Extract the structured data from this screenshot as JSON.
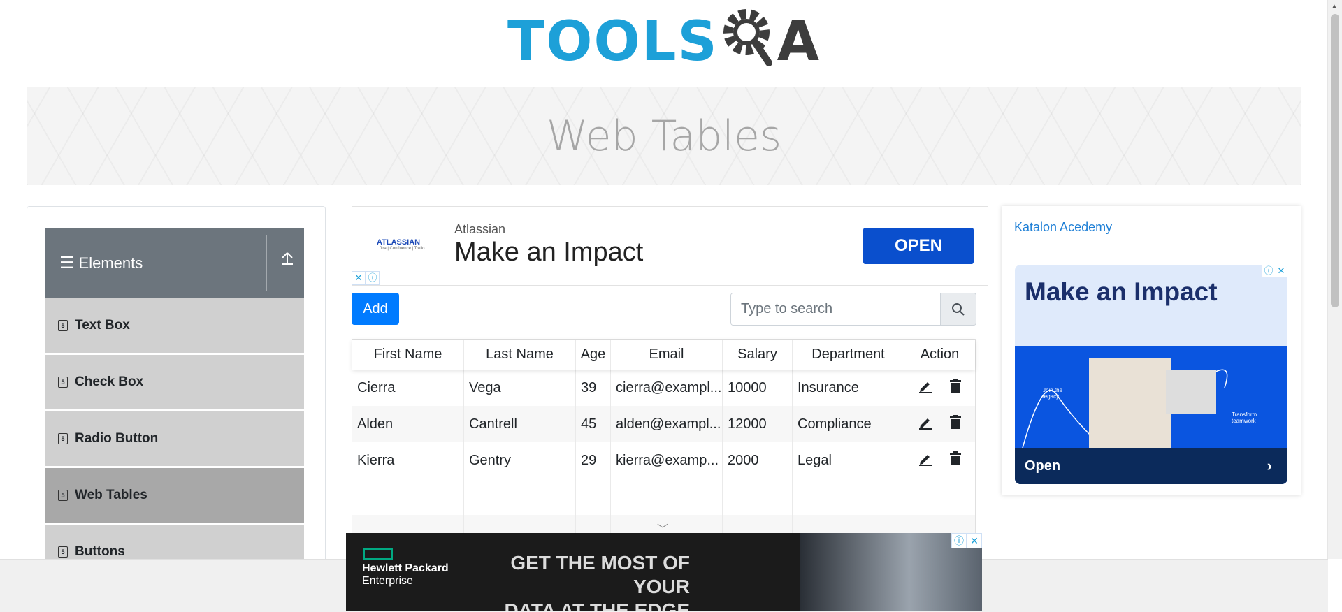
{
  "header": {
    "logo_tools": "TOOLS",
    "logo_qa": "QA"
  },
  "banner": {
    "title": "Web Tables"
  },
  "sidebar": {
    "group_label": "Elements",
    "items": [
      {
        "label": "Text Box"
      },
      {
        "label": "Check Box"
      },
      {
        "label": "Radio Button"
      },
      {
        "label": "Web Tables",
        "active": true
      },
      {
        "label": "Buttons"
      }
    ]
  },
  "ad_top": {
    "brand": "ATLASSIAN",
    "brand_sub": "Jira | Confluence | Trello",
    "advertiser": "Atlassian",
    "headline": "Make an Impact",
    "cta": "OPEN"
  },
  "toolbar": {
    "add_label": "Add",
    "search_placeholder": "Type to search"
  },
  "table": {
    "headers": [
      "First Name",
      "Last Name",
      "Age",
      "Email",
      "Salary",
      "Department",
      "Action"
    ],
    "rows": [
      {
        "first": "Cierra",
        "last": "Vega",
        "age": "39",
        "email": "cierra@exampl...",
        "salary": "10000",
        "department": "Insurance"
      },
      {
        "first": "Alden",
        "last": "Cantrell",
        "age": "45",
        "email": "alden@exampl...",
        "salary": "12000",
        "department": "Compliance"
      },
      {
        "first": "Kierra",
        "last": "Gentry",
        "age": "29",
        "email": "kierra@examp...",
        "salary": "2000",
        "department": "Legal"
      }
    ]
  },
  "side_ad": {
    "broken_image_alt": "Katalon Acedemy",
    "headline": "Make an Impact",
    "cta": "Open",
    "tag1": "Join the legacy",
    "tag2": "Transform teamwork"
  },
  "bottom_ad": {
    "company_line1": "Hewlett Packard",
    "company_line2": "Enterprise",
    "message_line1": "GET THE MOST OF YOUR",
    "message_line2": "DATA AT THE EDGE"
  },
  "colors": {
    "primary": "#007bff",
    "sidebar_header": "#6c757d",
    "logo_blue": "#1da0d8",
    "ad_blue": "#0a4fcd"
  }
}
